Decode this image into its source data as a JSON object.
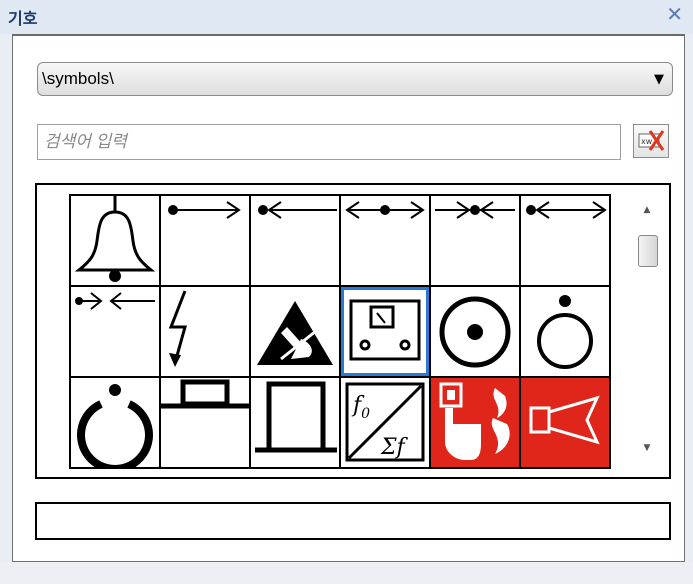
{
  "window": {
    "title": "기호",
    "close_glyph": "✕"
  },
  "library": {
    "selected": "\\symbols\\",
    "arrow_glyph": "▼"
  },
  "search": {
    "placeholder": "검색어 입력",
    "value": "",
    "clear_icon": "clear-search-icon"
  },
  "symbols": [
    {
      "name": "bell-symbol"
    },
    {
      "name": "dot-arrow-right-symbol"
    },
    {
      "name": "dot-arrow-left-symbol"
    },
    {
      "name": "double-arrow-outward-symbol"
    },
    {
      "name": "arrows-inward-dot-symbol"
    },
    {
      "name": "dot-arrows-outward-symbol"
    },
    {
      "name": "arrows-converge-symbol"
    },
    {
      "name": "lightning-symbol"
    },
    {
      "name": "esd-warning-symbol"
    },
    {
      "name": "meter-device-symbol",
      "selected": true
    },
    {
      "name": "circle-dot-symbol"
    },
    {
      "name": "circle-with-dot-above-symbol"
    },
    {
      "name": "broken-ring-symbol"
    },
    {
      "name": "pushbutton-flat-symbol"
    },
    {
      "name": "pushbutton-tall-symbol"
    },
    {
      "name": "frequency-converter-symbol",
      "text_top": "f0",
      "text_bottom": "Σf"
    },
    {
      "name": "fire-alarm-button-symbol",
      "color": "#e0261b"
    },
    {
      "name": "fire-horn-symbol",
      "color": "#e0261b"
    }
  ],
  "scrollbar": {
    "up": "▲",
    "down": "▼"
  },
  "status_text": ""
}
